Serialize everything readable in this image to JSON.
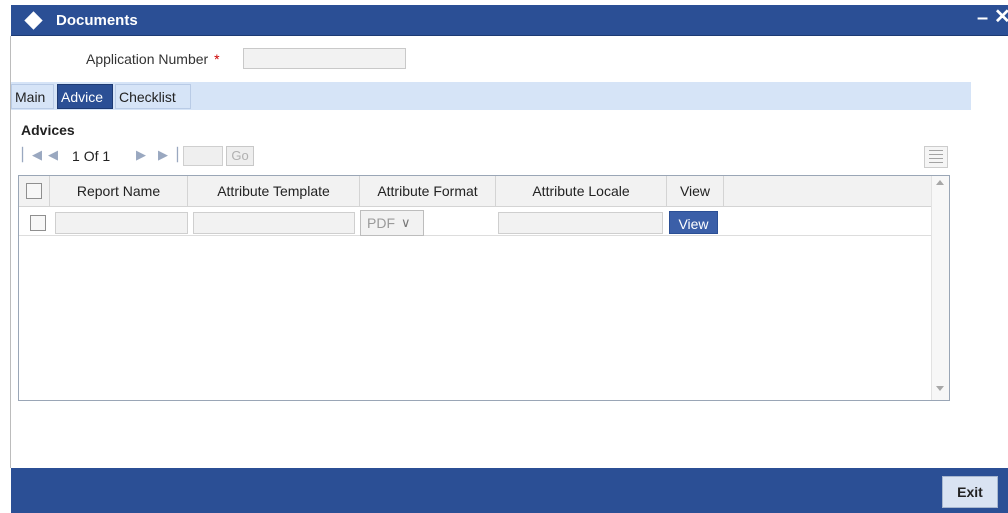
{
  "window": {
    "title": "Documents",
    "minimize_glyph": "–",
    "close_glyph": "✕"
  },
  "application": {
    "label": "Application Number",
    "required_mark": "*",
    "value": ""
  },
  "tabs": [
    {
      "label": "Main",
      "active": false
    },
    {
      "label": "Advice",
      "active": true
    },
    {
      "label": "Checklist",
      "active": false
    }
  ],
  "advices": {
    "title": "Advices",
    "pagination": {
      "current": "1",
      "of_label": "Of",
      "total": "1",
      "go_label": "Go",
      "page_input": ""
    },
    "columns": [
      "Report Name",
      "Attribute Template",
      "Attribute Format",
      "Attribute Locale",
      "View"
    ],
    "rows": [
      {
        "report_name": "",
        "attribute_template": "",
        "attribute_format": "PDF",
        "attribute_locale": "",
        "view_label": "View"
      }
    ]
  },
  "footer": {
    "exit_label": "Exit"
  },
  "colors": {
    "titlebar": "#2b4f95",
    "tabbar": "#d6e4f7",
    "active_tab": "#2b4f95",
    "required": "#cc0000"
  }
}
